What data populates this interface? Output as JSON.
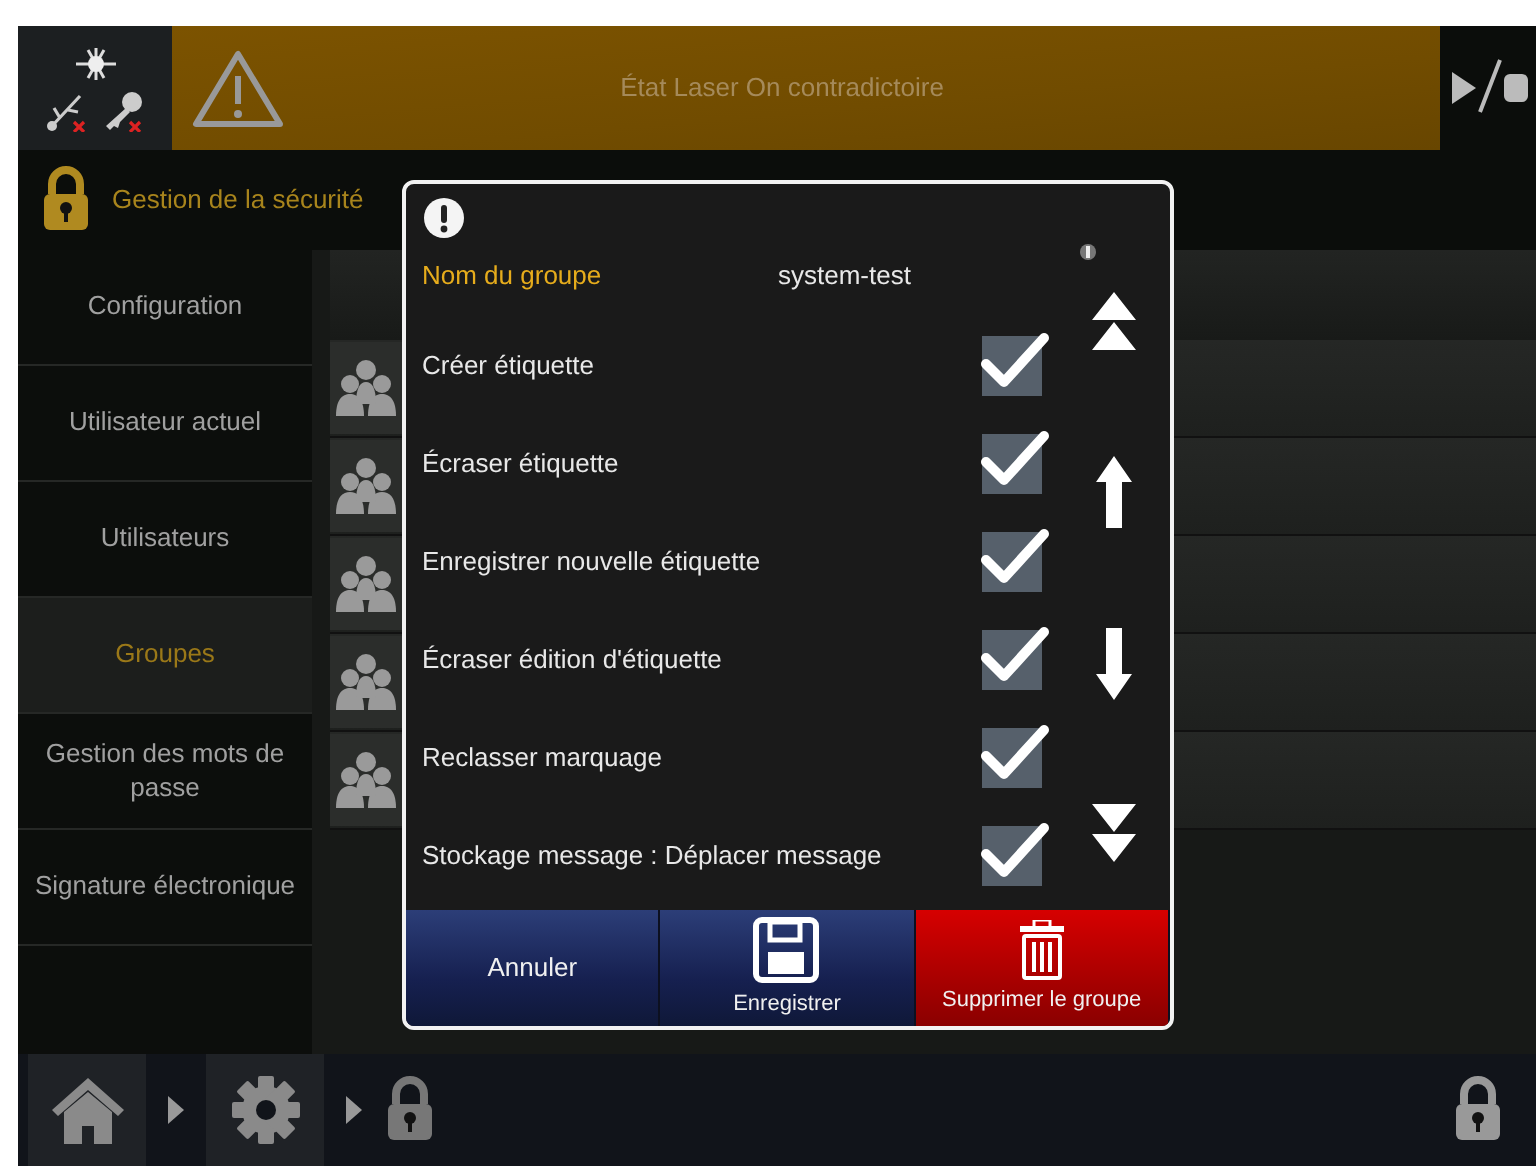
{
  "header": {
    "banner_text": "État Laser On contradictoire"
  },
  "section_title": "Gestion de la sécurité",
  "sidebar": {
    "items": [
      {
        "label": "Configuration",
        "selected": false
      },
      {
        "label": "Utilisateur actuel",
        "selected": false
      },
      {
        "label": "Utilisateurs",
        "selected": false
      },
      {
        "label": "Groupes",
        "selected": true
      },
      {
        "label": "Gestion des mots de passe",
        "selected": false
      },
      {
        "label": "Signature électronique",
        "selected": false
      }
    ]
  },
  "dialog": {
    "group_name_label": "Nom du groupe",
    "group_name_value": "system-test",
    "permissions": [
      {
        "label": "Créer étiquette",
        "checked": true
      },
      {
        "label": "Écraser étiquette",
        "checked": true
      },
      {
        "label": "Enregistrer nouvelle étiquette",
        "checked": true
      },
      {
        "label": "Écraser édition d'étiquette",
        "checked": true
      },
      {
        "label": "Reclasser marquage",
        "checked": true
      },
      {
        "label": "Stockage message : Déplacer message",
        "checked": true
      }
    ],
    "buttons": [
      {
        "label": "Annuler",
        "kind": "cancel"
      },
      {
        "label": "Enregistrer",
        "kind": "save"
      },
      {
        "label": "Supprimer le groupe",
        "kind": "delete"
      }
    ]
  }
}
